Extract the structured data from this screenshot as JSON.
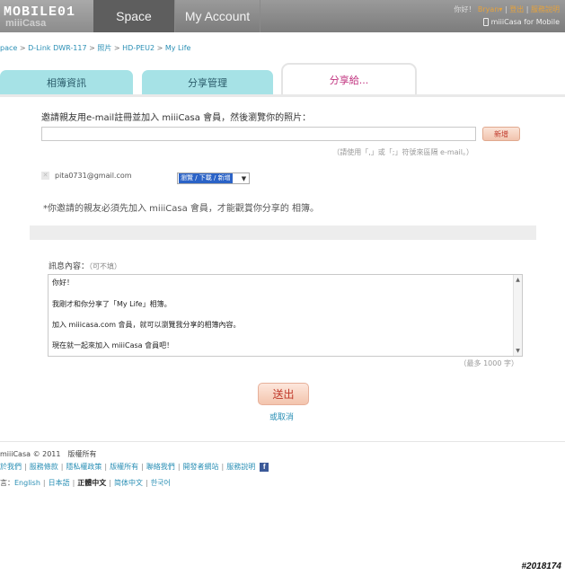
{
  "header": {
    "logo_text": "MOBILE01",
    "logo_brand": "miiiCasa",
    "nav_space": "Space",
    "nav_account": "My Account",
    "greeting": "你好！",
    "user": "Bryan",
    "user_caret": "▾",
    "logout": "登出",
    "help": "服務說明",
    "mobile_link": "miiiCasa for Mobile"
  },
  "breadcrumb": {
    "items": [
      "pace",
      "D-Link DWR-117",
      "照片",
      "HD-PEU2",
      "My Life"
    ],
    "separator": ">"
  },
  "tabs": [
    {
      "label": "相簿資訊"
    },
    {
      "label": "分享管理"
    },
    {
      "label": "分享給..."
    }
  ],
  "invite": {
    "title": "邀請親友用e-mail註冊並加入 miiiCasa 會員，然後瀏覽你的照片：",
    "email_value": "",
    "add_label": "新增",
    "hint": "（請使用「,」或「;」符號來區隔 e-mail。）"
  },
  "invitee": {
    "email": "pita0731@gmail.com",
    "remove_glyph": "✕",
    "permission": "瀏覽 / 下載 / 新增",
    "arrow": "▼"
  },
  "notice": "*你邀請的親友必須先加入 miiiCasa 會員，才能觀賞你分享的 相簿。",
  "message": {
    "label": "訊息內容：",
    "optional": "（可不填）",
    "lines": [
      "你好！",
      " 我剛才和你分享了「My Life」相簿。",
      "加入 miiicasa.com 會員，就可以瀏覽我分享的相簿內容。",
      "現在就一起來加入 miiiCasa 會員吧！"
    ],
    "limit": "（最多 1000 字）"
  },
  "actions": {
    "submit": "送出",
    "cancel": "或取消"
  },
  "footer": {
    "copyright": "miiiCasa © 2011　版權所有",
    "links": [
      "於我們",
      "服務條款",
      "隱私權政策",
      "版權所有",
      "聯絡我們",
      "開發者網站",
      "服務說明"
    ],
    "fb": "f",
    "lang_label": "言：",
    "languages": [
      "English",
      "日本語",
      "正體中文",
      "简体中文",
      "한국어"
    ],
    "active_language": "正體中文"
  },
  "watermark": "#2018174",
  "colors": {
    "tab_active": "#c0317e",
    "tab_bg": "#a6e2e6",
    "link": "#2a8fb5",
    "accent_button": "#f1c3ad"
  }
}
